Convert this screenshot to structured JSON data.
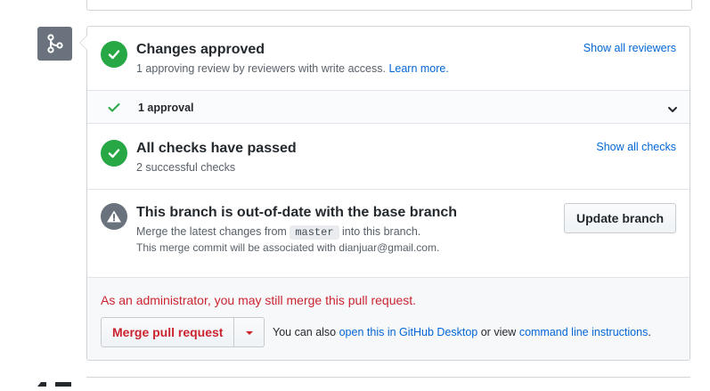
{
  "icons": {
    "merge": "git-merge-icon",
    "approved": "check-circle-icon",
    "approval_check": "check-icon",
    "chevron": "chevron-down-icon",
    "checks_passed": "check-circle-icon",
    "outdated": "alert-icon",
    "dropdown": "triangle-down-icon"
  },
  "colors": {
    "success": "#28a745",
    "link": "#0366d6",
    "danger": "#cb2431",
    "neutral": "#6a737d"
  },
  "approved": {
    "title": "Changes approved",
    "subtitle": "1 approving review by reviewers with write access.",
    "learn_more": "Learn more.",
    "show_all": "Show all reviewers"
  },
  "approval": {
    "label": "1 approval"
  },
  "checks": {
    "title": "All checks have passed",
    "subtitle": "2 successful checks",
    "show_all": "Show all checks"
  },
  "outdated": {
    "title": "This branch is out-of-date with the base branch",
    "line1_prefix": "Merge the latest changes from",
    "branch": "master",
    "line1_suffix": "into this branch.",
    "line2": "This merge commit will be associated with dianjuar@gmail.com.",
    "update_button": "Update branch"
  },
  "merge": {
    "admin_note": "As an administrator, you may still merge this pull request.",
    "merge_button": "Merge pull request",
    "alt_prefix": "You can also",
    "desktop_link": "open this in GitHub Desktop",
    "alt_middle": "or view",
    "cli_link": "command line instructions",
    "alt_suffix": "."
  }
}
